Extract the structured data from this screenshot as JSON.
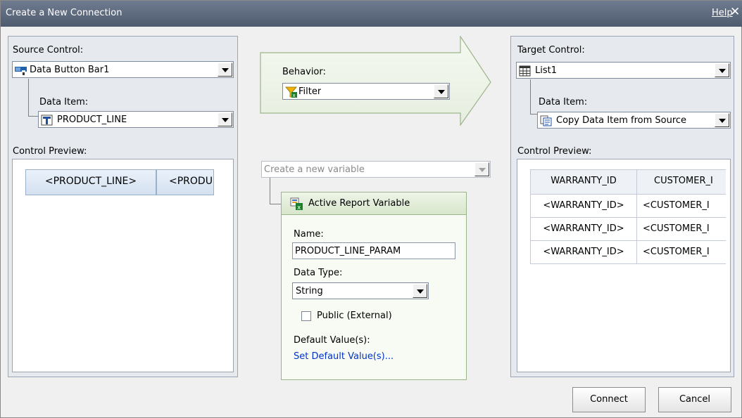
{
  "window": {
    "title": "Create a New Connection",
    "help_label": "Help",
    "close_glyph": "✕"
  },
  "source": {
    "control_label": "Source Control:",
    "control_value": "Data Button Bar1",
    "data_item_label": "Data Item:",
    "data_item_value": "PRODUCT_LINE",
    "preview_label": "Control Preview:",
    "preview_buttons": [
      "<PRODUCT_LINE>",
      "<PRODU"
    ]
  },
  "behavior": {
    "label": "Behavior:",
    "value": "Filter"
  },
  "variable": {
    "select_placeholder": "Create a new variable",
    "panel_title": "Active Report Variable",
    "name_label": "Name:",
    "name_value": "PRODUCT_LINE_PARAM",
    "type_label": "Data Type:",
    "type_value": "String",
    "public_label": "Public (External)",
    "public_checked": false,
    "default_label": "Default Value(s):",
    "default_link": "Set Default Value(s)..."
  },
  "target": {
    "control_label": "Target Control:",
    "control_value": "List1",
    "data_item_label": "Data Item:",
    "data_item_value": "Copy Data Item from Source",
    "preview_label": "Control Preview:",
    "table": {
      "headers": [
        "WARRANTY_ID",
        "CUSTOMER_I"
      ],
      "rows": [
        [
          "<WARRANTY_ID>",
          "<CUSTOMER_I"
        ],
        [
          "<WARRANTY_ID>",
          "<CUSTOMER_I"
        ],
        [
          "<WARRANTY_ID>",
          "<CUSTOMER_I"
        ]
      ]
    }
  },
  "footer": {
    "connect_label": "Connect",
    "cancel_label": "Cancel"
  },
  "icons": {
    "source_control": "data-button-bar-icon",
    "source_data_item": "data-item-icon",
    "behavior": "filter-icon",
    "variable": "variable-icon",
    "target_control": "list-icon",
    "target_data_item": "copy-data-item-icon"
  }
}
